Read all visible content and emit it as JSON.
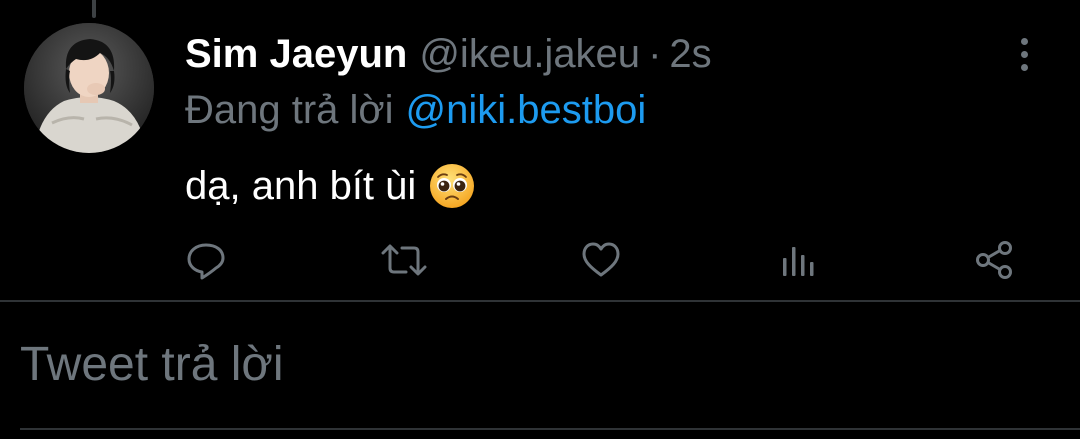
{
  "tweet": {
    "display_name": "Sim Jaeyun",
    "handle": "@ikeu.jakeu",
    "separator": "·",
    "time": "2s",
    "reply_prefix": "Đang trả lời",
    "reply_mention": "@niki.bestboi",
    "text": "dạ, anh bít ùi",
    "emoji": "pleading-face"
  },
  "actions": {
    "reply": "reply-icon",
    "retweet": "retweet-icon",
    "like": "heart-icon",
    "analytics": "analytics-icon",
    "share": "share-icon"
  },
  "composer": {
    "placeholder": "Tweet trả lời"
  },
  "colors": {
    "background": "#000000",
    "text_primary": "#ffffff",
    "text_secondary": "#6e767d",
    "link": "#1d9bf0",
    "divider": "#2f3336"
  }
}
